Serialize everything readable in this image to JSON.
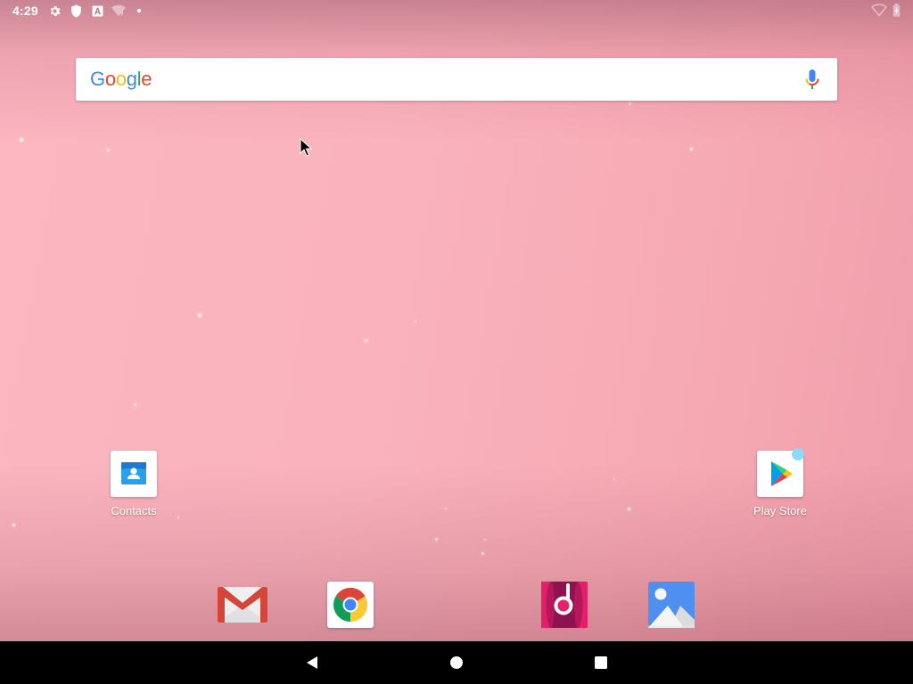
{
  "status_bar": {
    "time": "4:29",
    "left_icons": [
      "settings-icon",
      "shield-icon",
      "font-a-icon",
      "wifi-question-icon",
      "dot-icon"
    ],
    "right_icons": [
      "wifi-empty-icon",
      "battery-charging-icon"
    ]
  },
  "search": {
    "logo_letters": [
      {
        "ch": "G",
        "color": "#4285F4"
      },
      {
        "ch": "o",
        "color": "#EA4335"
      },
      {
        "ch": "o",
        "color": "#FBBC05"
      },
      {
        "ch": "g",
        "color": "#4285F4"
      },
      {
        "ch": "l",
        "color": "#34A853"
      },
      {
        "ch": "e",
        "color": "#EA4335"
      }
    ],
    "mic_icon": "mic-icon"
  },
  "home_apps": [
    {
      "label": "Contacts",
      "icon": "contacts-icon"
    },
    {
      "label": "Play Store",
      "icon": "play-store-icon",
      "badge": "notification-dot"
    }
  ],
  "dock": [
    {
      "name": "Gmail",
      "icon": "gmail-icon"
    },
    {
      "name": "Chrome",
      "icon": "chrome-icon"
    },
    {
      "name": "Music",
      "icon": "music-icon"
    },
    {
      "name": "Gallery",
      "icon": "gallery-icon"
    }
  ],
  "nav_bar": {
    "buttons": [
      "back",
      "home",
      "recents"
    ]
  },
  "colors": {
    "wallpaper_pink": "#fab3bd",
    "nav_bar": "#000000",
    "notification_dot": "#8fd8f8"
  }
}
